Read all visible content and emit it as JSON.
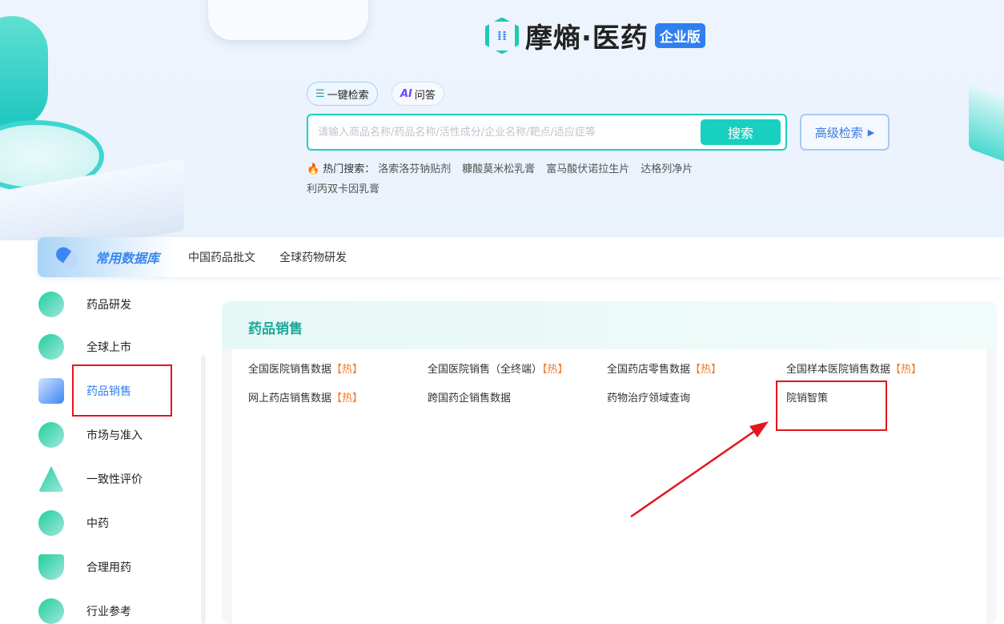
{
  "header": {
    "logo": "摩熵·医药",
    "edition_badge": "企业版"
  },
  "search_modes": [
    {
      "label": "一键检索",
      "icon": "search-list-icon"
    },
    {
      "label": "问答",
      "prefix": "AI",
      "icon": "ai-sparkle-icon"
    }
  ],
  "search": {
    "placeholder": "请输入商品名称/药品名称/活性成分/企业名称/靶点/适应症等",
    "value": "",
    "button": "搜索",
    "advanced": "高级检索"
  },
  "hot_search": {
    "label": "热门搜索：",
    "items": [
      "洛索洛芬钠贴剂",
      "糠酸莫米松乳膏",
      "富马酸伏诺拉生片",
      "达格列净片",
      "利丙双卡因乳膏"
    ]
  },
  "databases": {
    "title": "常用数据库",
    "tabs": [
      "中国药品批文",
      "全球药物研发"
    ]
  },
  "sidebar": {
    "items": [
      {
        "label": "药品研发"
      },
      {
        "label": "全球上市"
      },
      {
        "label": "药品销售",
        "selected": true
      },
      {
        "label": "市场与准入"
      },
      {
        "label": "一致性评价"
      },
      {
        "label": "中药"
      },
      {
        "label": "合理用药"
      },
      {
        "label": "行业参考"
      }
    ]
  },
  "panel": {
    "title": "药品销售",
    "hot_tag": "【热】",
    "links": [
      {
        "label": "全国医院销售数据",
        "hot": true
      },
      {
        "label": "全国医院销售（全终端）",
        "hot": true
      },
      {
        "label": "全国药店零售数据",
        "hot": true
      },
      {
        "label": "全国样本医院销售数据",
        "hot": true
      },
      {
        "label": "网上药店销售数据",
        "hot": true
      },
      {
        "label": "跨国药企销售数据",
        "hot": false
      },
      {
        "label": "药物治疗领域查询",
        "hot": false
      },
      {
        "label": "院销智策",
        "hot": false
      }
    ]
  },
  "colors": {
    "accent": "#17d0bf",
    "brand_blue": "#2f7ff0",
    "highlight_red": "#e3161f",
    "hot_orange": "#f07a2a"
  }
}
